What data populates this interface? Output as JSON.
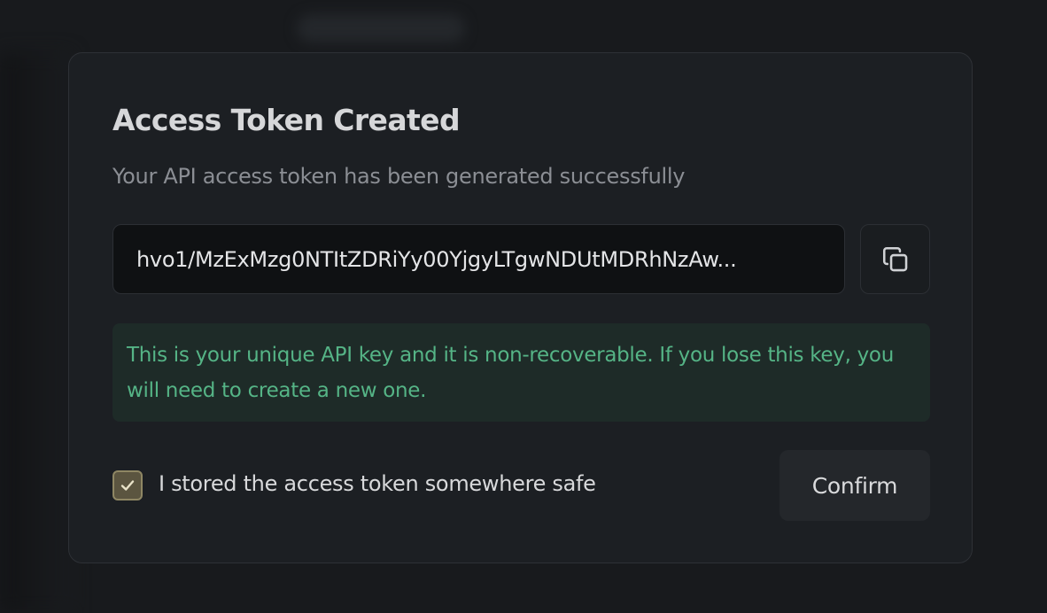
{
  "modal": {
    "title": "Access Token Created",
    "subtitle": "Your API access token has been generated successfully",
    "token": {
      "value": "hvo1/MzExMzg0NTItZDRiYy00YjgyLTgwNDUtMDRhNzAw..."
    },
    "copy_icon": "copy-icon",
    "warning_text": "This is your unique API key and it is non-recoverable. If you lose this key, you will need to create a new one.",
    "confirmation": {
      "checked": true,
      "label": "I stored the access token somewhere safe"
    },
    "confirm_label": "Confirm"
  },
  "colors": {
    "background": "#17191c",
    "modal_background": "#1c1f23",
    "warning_background": "#1e2b28",
    "warning_text": "#55b486",
    "checkbox_fill": "#5b5540"
  }
}
